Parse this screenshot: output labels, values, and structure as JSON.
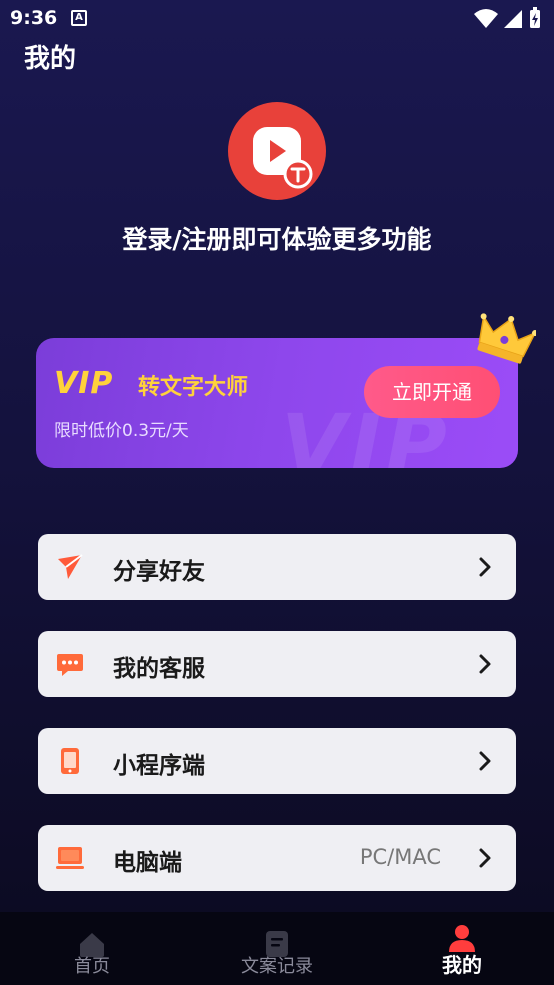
{
  "status_bar": {
    "time": "9:36",
    "notification_letter": "A"
  },
  "header": {
    "title": "我的"
  },
  "profile": {
    "login_prompt": "登录/注册即可体验更多功能"
  },
  "vip": {
    "logo": "VIP",
    "title": "转文字大师",
    "subtitle": "限时低价0.3元/天",
    "button_label": "立即开通",
    "watermark": "VIP"
  },
  "menu": [
    {
      "label": "分享好友",
      "icon": "share-icon",
      "extra": ""
    },
    {
      "label": "我的客服",
      "icon": "chat-icon",
      "extra": ""
    },
    {
      "label": "小程序端",
      "icon": "phone-icon",
      "extra": ""
    },
    {
      "label": "电脑端",
      "icon": "laptop-icon",
      "extra": "PC/MAC"
    }
  ],
  "tabs": [
    {
      "label": "首页",
      "icon": "home-icon",
      "active": false
    },
    {
      "label": "文案记录",
      "icon": "document-icon",
      "active": false
    },
    {
      "label": "我的",
      "icon": "user-icon",
      "active": true
    }
  ],
  "colors": {
    "accent_red": "#e8413a",
    "vip_gold": "#ffd23b",
    "vip_purple": "#8e47ec",
    "button_pink": "#ff5a8a"
  }
}
